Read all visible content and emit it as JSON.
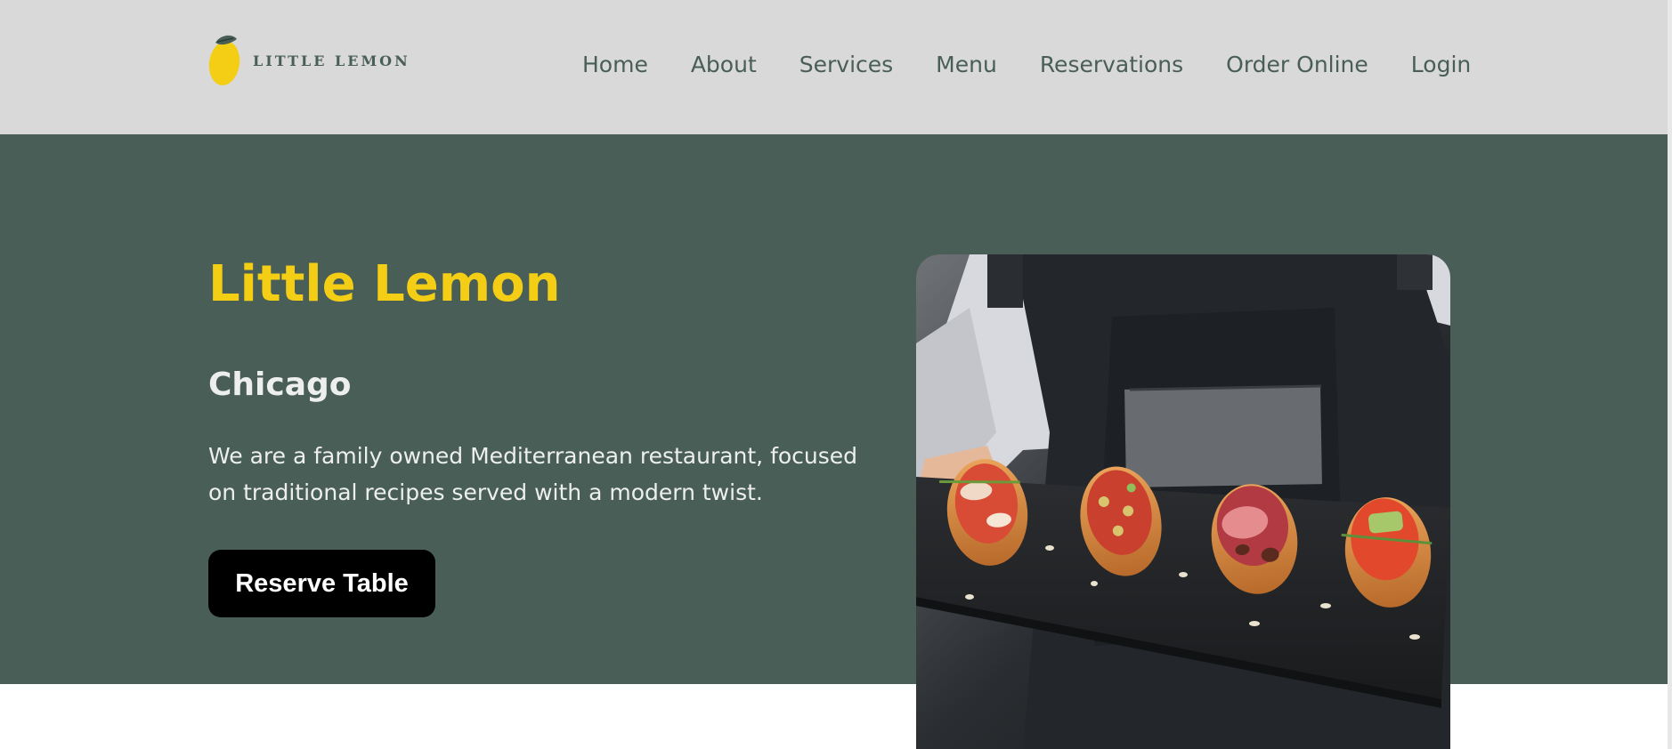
{
  "brand": {
    "logo_text": "LITTLE LEMON",
    "logo_icon": "lemon-icon"
  },
  "nav": {
    "items": [
      {
        "label": "Home"
      },
      {
        "label": "About"
      },
      {
        "label": "Services"
      },
      {
        "label": "Menu"
      },
      {
        "label": "Reservations"
      },
      {
        "label": "Order Online"
      },
      {
        "label": "Login"
      }
    ]
  },
  "hero": {
    "title": "Little Lemon",
    "city": "Chicago",
    "description": "We are a family owned Mediterranean restaurant, focused on traditional recipes served with a modern twist.",
    "cta_label": "Reserve Table",
    "photo_alt": "Server holding a slate board of bruschetta"
  },
  "colors": {
    "header_bg": "#d9d9d9",
    "hero_bg": "#495e57",
    "accent_yellow": "#f4ce14",
    "text_light": "#edefee",
    "button_bg": "#000000"
  }
}
